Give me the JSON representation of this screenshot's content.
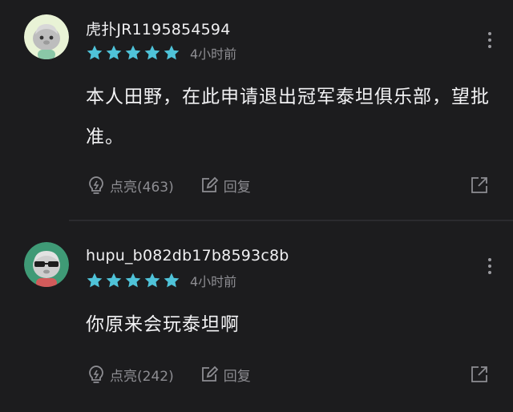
{
  "comments": [
    {
      "username": "虎扑JR1195854594",
      "time": "4小时前",
      "rating": 5,
      "content": "本人田野，在此申请退出冠军泰坦俱乐部，望批准。",
      "like_label": "点亮(463)",
      "reply_label": "回复"
    },
    {
      "username": "hupu_b082db17b8593c8b",
      "time": "4小时前",
      "rating": 5,
      "content": "你原来会玩泰坦啊",
      "like_label": "点亮(242)",
      "reply_label": "回复"
    }
  ],
  "colors": {
    "background": "#1c1c1e",
    "star": "#4fc3d9",
    "muted": "#8d8d92"
  },
  "icons": [
    "avatar-icon",
    "star-icon",
    "more-icon",
    "light-bulb-icon",
    "reply-edit-icon",
    "share-icon"
  ]
}
